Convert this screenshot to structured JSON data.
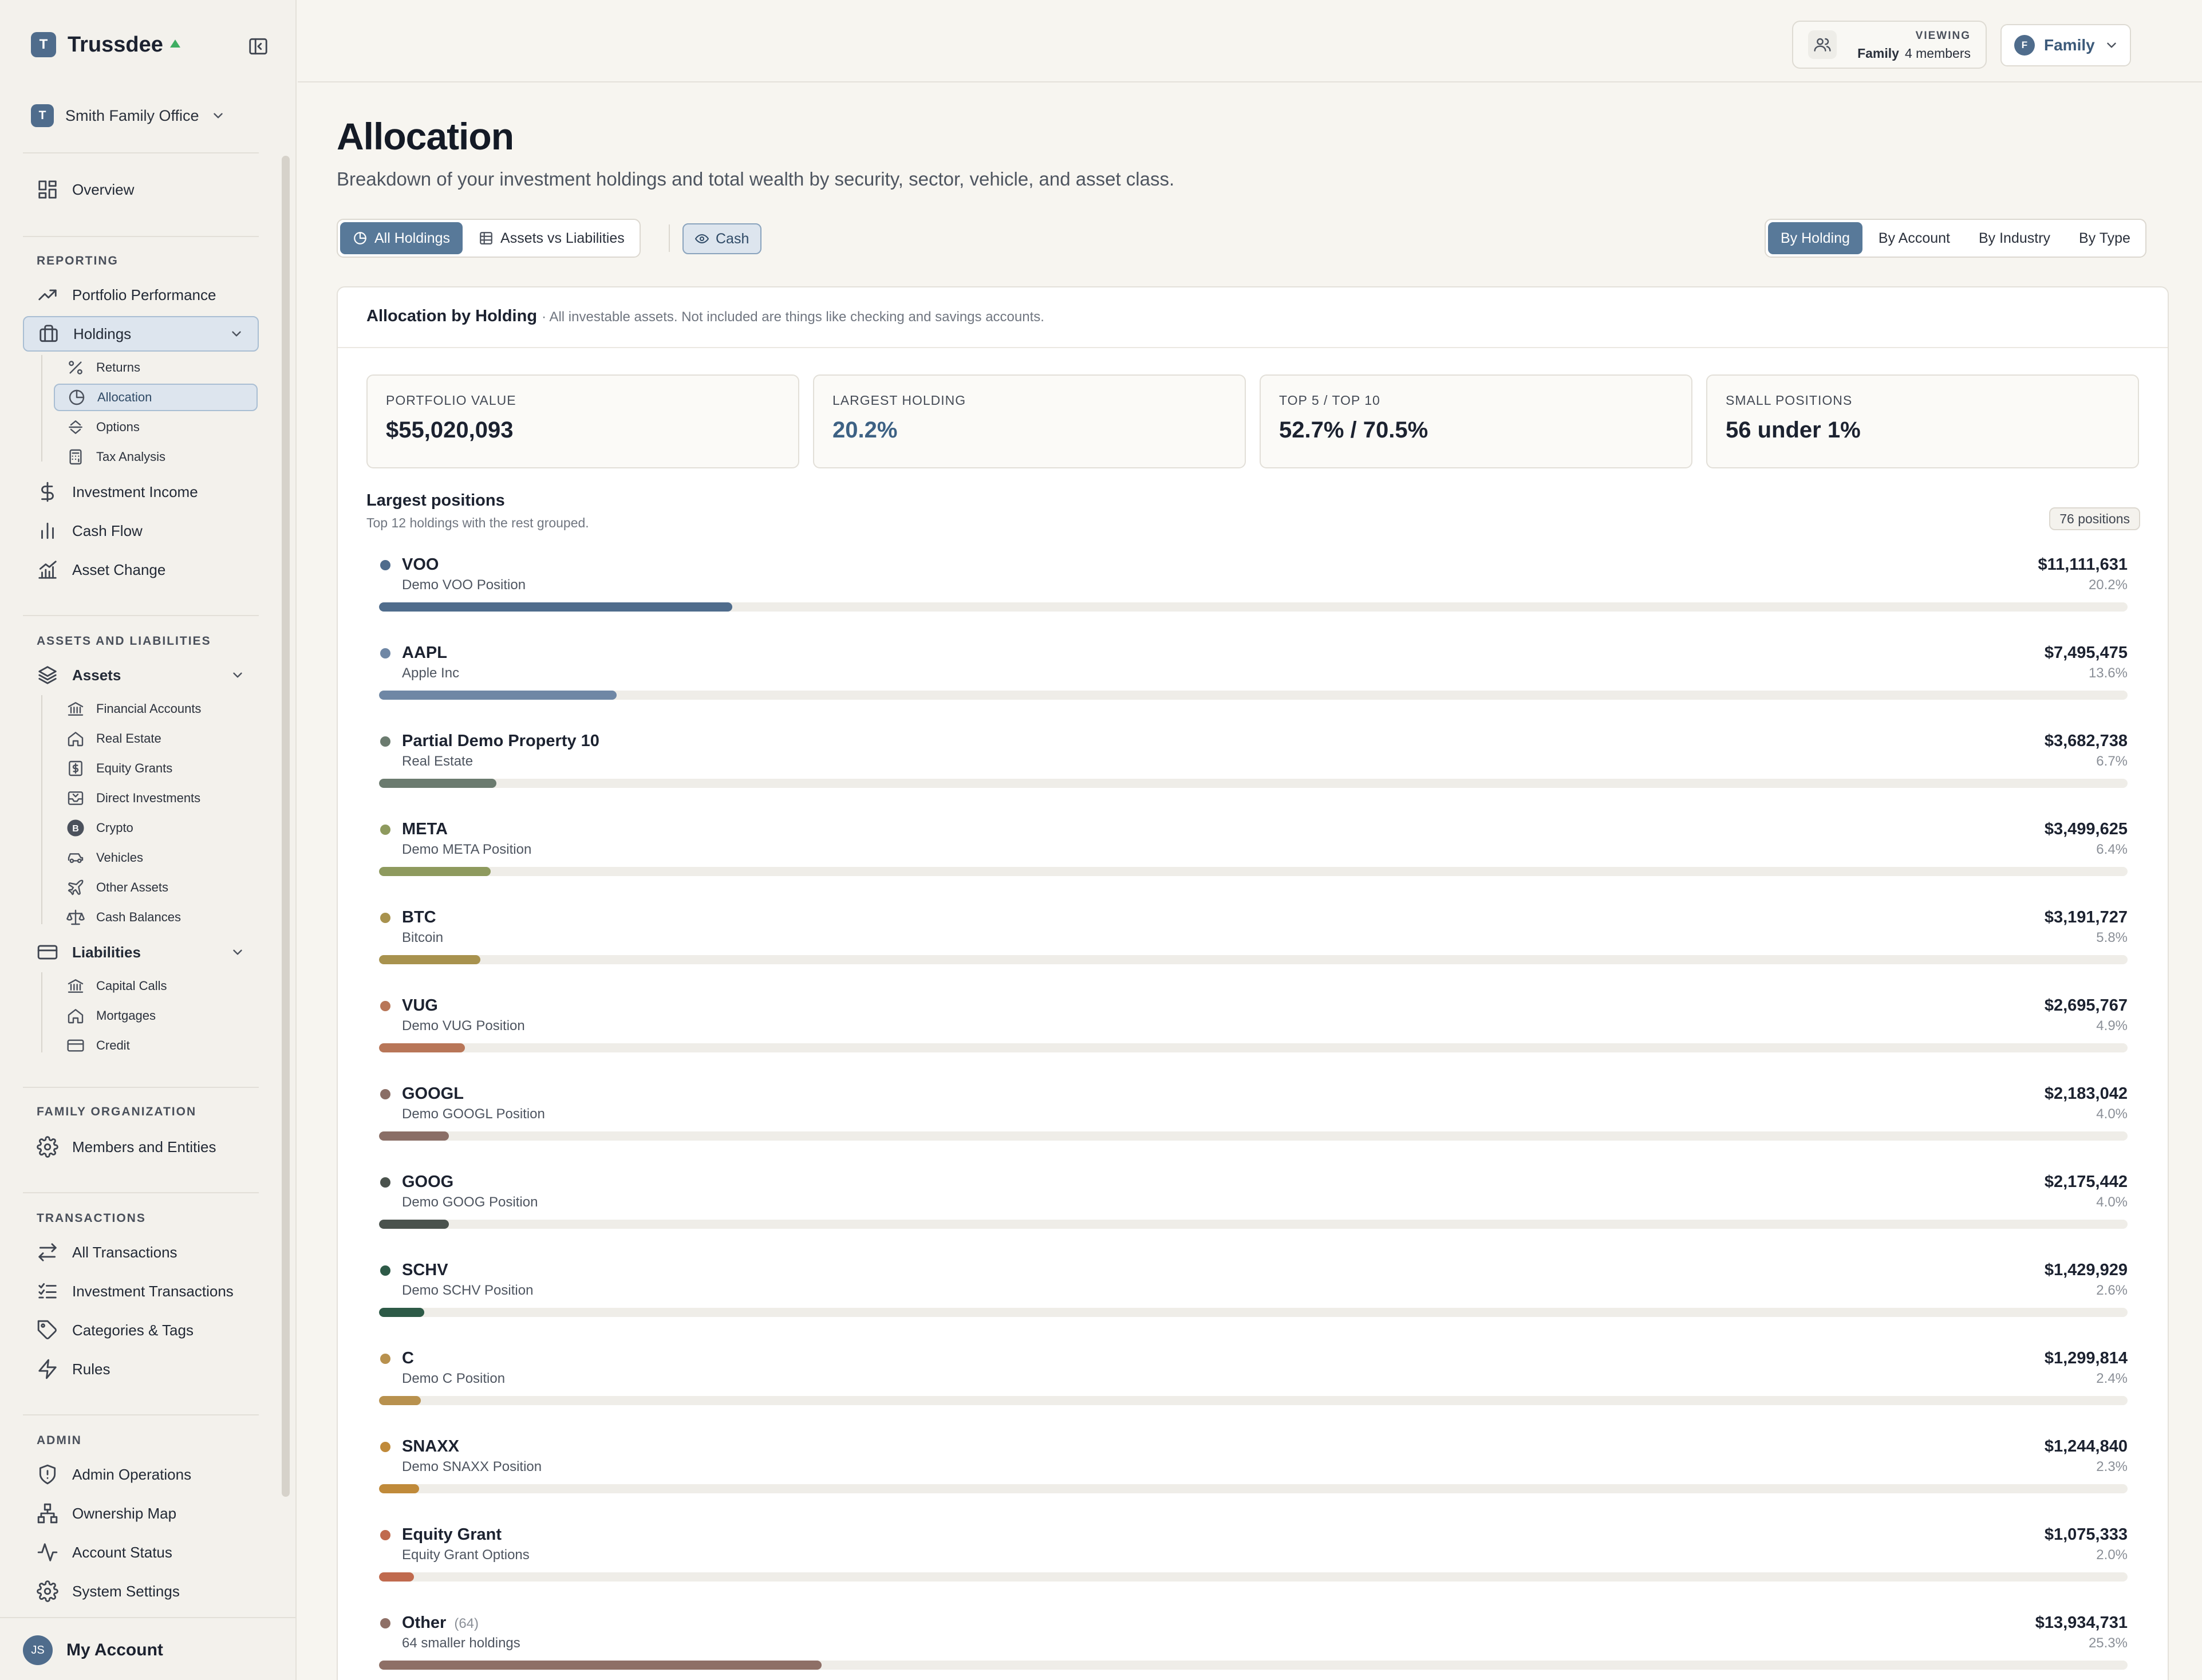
{
  "app": {
    "name": "Trussdee",
    "logo_letter": "T"
  },
  "org": {
    "name": "Smith Family Office",
    "logo_letter": "T"
  },
  "nav": {
    "overview": "Overview",
    "reporting_header": "REPORTING",
    "portfolio_performance": "Portfolio Performance",
    "holdings": "Holdings",
    "holdings_sub": [
      "Returns",
      "Allocation",
      "Options",
      "Tax Analysis"
    ],
    "investment_income": "Investment Income",
    "cash_flow": "Cash Flow",
    "asset_change": "Asset Change",
    "assets_liabilities_header": "ASSETS AND LIABILITIES",
    "assets": "Assets",
    "assets_sub": [
      "Financial Accounts",
      "Real Estate",
      "Equity Grants",
      "Direct Investments",
      "Crypto",
      "Vehicles",
      "Other Assets",
      "Cash Balances"
    ],
    "liabilities": "Liabilities",
    "liabilities_sub": [
      "Capital Calls",
      "Mortgages",
      "Credit"
    ],
    "family_org_header": "FAMILY ORGANIZATION",
    "members_entities": "Members and Entities",
    "transactions_header": "TRANSACTIONS",
    "all_transactions": "All Transactions",
    "investment_transactions": "Investment Transactions",
    "categories_tags": "Categories & Tags",
    "rules": "Rules",
    "admin_header": "ADMIN",
    "admin_operations": "Admin Operations",
    "ownership_map": "Ownership Map",
    "account_status": "Account Status",
    "system_settings": "System Settings"
  },
  "account": {
    "initials": "JS",
    "label": "My Account"
  },
  "topbar": {
    "viewing_label": "VIEWING",
    "viewing_name": "Family",
    "viewing_members": "4 members",
    "family_initial": "F",
    "family_select": "Family"
  },
  "page": {
    "title": "Allocation",
    "subtitle": "Breakdown of your investment holdings and total wealth by security, sector, vehicle, and asset class."
  },
  "view_tabs": [
    "All Holdings",
    "Assets vs Liabilities"
  ],
  "cash_toggle": "Cash",
  "group_tabs": [
    "By Holding",
    "By Account",
    "By Industry",
    "By Type"
  ],
  "card": {
    "title": "Allocation by Holding",
    "note": "· All investable assets. Not included are things like checking and savings accounts."
  },
  "stats": [
    {
      "label": "PORTFOLIO VALUE",
      "value": "$55,020,093"
    },
    {
      "label": "LARGEST HOLDING",
      "value": "20.2%"
    },
    {
      "label": "TOP 5 / TOP 10",
      "value": "52.7% / 70.5%"
    },
    {
      "label": "SMALL POSITIONS",
      "value": "56 under 1%"
    }
  ],
  "positions": {
    "title": "Largest positions",
    "subtitle": "Top 12 holdings with the rest grouped.",
    "count": "76 positions",
    "rows": [
      {
        "name": "VOO",
        "desc": "Demo VOO Position",
        "value": "$11,111,631",
        "pct": "20.2%",
        "share": 0.202,
        "color": "#4f6c8c"
      },
      {
        "name": "AAPL",
        "desc": "Apple Inc",
        "value": "$7,495,475",
        "pct": "13.6%",
        "share": 0.136,
        "color": "#6f87a5"
      },
      {
        "name": "Partial Demo Property 10",
        "desc": "Real Estate",
        "value": "$3,682,738",
        "pct": "6.7%",
        "share": 0.067,
        "color": "#6b7b6f"
      },
      {
        "name": "META",
        "desc": "Demo META Position",
        "value": "$3,499,625",
        "pct": "6.4%",
        "share": 0.064,
        "color": "#8e9a5e"
      },
      {
        "name": "BTC",
        "desc": "Bitcoin",
        "value": "$3,191,727",
        "pct": "5.8%",
        "share": 0.058,
        "color": "#a8924e"
      },
      {
        "name": "VUG",
        "desc": "Demo VUG Position",
        "value": "$2,695,767",
        "pct": "4.9%",
        "share": 0.049,
        "color": "#b87658"
      },
      {
        "name": "GOOGL",
        "desc": "Demo GOOGL Position",
        "value": "$2,183,042",
        "pct": "4.0%",
        "share": 0.04,
        "color": "#8a6e66"
      },
      {
        "name": "GOOG",
        "desc": "Demo GOOG Position",
        "value": "$2,175,442",
        "pct": "4.0%",
        "share": 0.04,
        "color": "#4a524d"
      },
      {
        "name": "SCHV",
        "desc": "Demo SCHV Position",
        "value": "$1,429,929",
        "pct": "2.6%",
        "share": 0.026,
        "color": "#2d5a47"
      },
      {
        "name": "C",
        "desc": "Demo C Position",
        "value": "$1,299,814",
        "pct": "2.4%",
        "share": 0.024,
        "color": "#b8914e"
      },
      {
        "name": "SNAXX",
        "desc": "Demo SNAXX Position",
        "value": "$1,244,840",
        "pct": "2.3%",
        "share": 0.023,
        "color": "#c08a3a"
      },
      {
        "name": "Equity Grant",
        "desc": "Equity Grant Options",
        "value": "$1,075,333",
        "pct": "2.0%",
        "share": 0.02,
        "color": "#c06a4e"
      },
      {
        "name": "Other",
        "count": "(64)",
        "desc": "64 smaller holdings",
        "value": "$13,934,731",
        "pct": "25.3%",
        "share": 0.253,
        "color": "#8e6f66"
      }
    ]
  },
  "colors": {
    "accent": "#587999",
    "brand": "#4f6c8c",
    "selected_bg": "#dde5ee"
  }
}
